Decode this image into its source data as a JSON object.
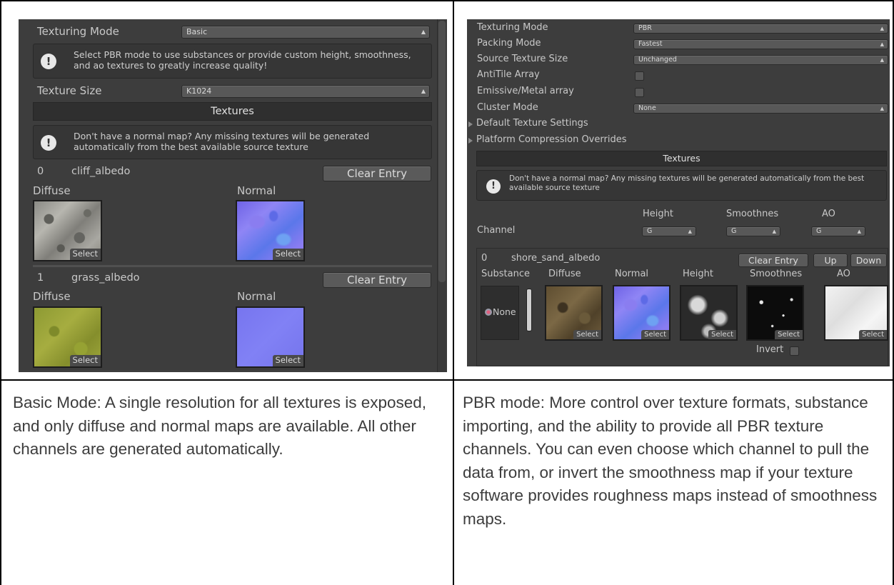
{
  "basic": {
    "texturing_mode_label": "Texturing Mode",
    "texturing_mode_value": "Basic",
    "help1": "Select PBR mode to use substances or provide custom height, smoothness, and ao textures to greatly increase quality!",
    "texture_size_label": "Texture Size",
    "texture_size_value": "K1024",
    "textures_header": "Textures",
    "help2": "Don't have a normal map? Any missing textures will be generated automatically from the best available source texture",
    "entries": [
      {
        "index": "0",
        "name": "cliff_albedo",
        "clear": "Clear Entry",
        "diffuse": "Diffuse",
        "normal": "Normal",
        "select": "Select"
      },
      {
        "index": "1",
        "name": "grass_albedo",
        "clear": "Clear Entry",
        "diffuse": "Diffuse",
        "normal": "Normal",
        "select": "Select"
      }
    ]
  },
  "pbr": {
    "texturing_mode_label": "Texturing Mode",
    "texturing_mode_value": "PBR",
    "packing_mode_label": "Packing Mode",
    "packing_mode_value": "Fastest",
    "source_size_label": "Source Texture Size",
    "source_size_value": "Unchanged",
    "antitile_label": "AntiTile Array",
    "emissive_label": "Emissive/Metal array",
    "cluster_label": "Cluster Mode",
    "cluster_value": "None",
    "default_settings": "Default Texture Settings",
    "platform_overrides": "Platform Compression Overrides",
    "textures_header": "Textures",
    "help": "Don't have a normal map? Any missing textures will be generated automatically from the best available source texture",
    "channel_label": "Channel",
    "channels": [
      {
        "name": "Height",
        "value": "G"
      },
      {
        "name": "Smoothnes",
        "value": "G"
      },
      {
        "name": "AO",
        "value": "G"
      }
    ],
    "entry": {
      "index": "0",
      "name": "shore_sand_albedo",
      "clear": "Clear Entry",
      "up": "Up",
      "down": "Down",
      "cols": [
        "Substance",
        "Diffuse",
        "Normal",
        "Height",
        "Smoothnes",
        "AO"
      ],
      "substance_value": "None",
      "select": "Select",
      "invert": "Invert"
    }
  },
  "captions": {
    "left": "Basic Mode: A single resolution for all textures is exposed, and only diffuse and normal maps are available. All other channels are generated automatically.",
    "right": "PBR mode: More control over texture formats, substance importing, and the ability to provide all PBR texture channels. You can even choose which channel to pull the data from, or invert the smoothness map if your texture software provides roughness maps instead of smoothness maps."
  }
}
